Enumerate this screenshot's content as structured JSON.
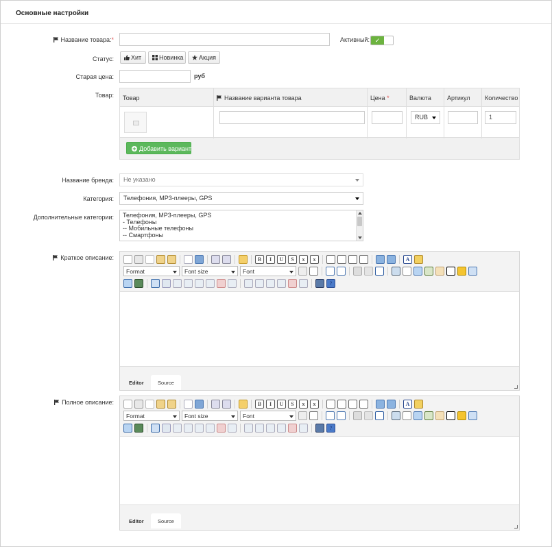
{
  "panel_title": "Основные настройки",
  "product_name": {
    "label": "Название товара:",
    "required_mark": "*",
    "value": ""
  },
  "active": {
    "label": "Активный:",
    "state": "on",
    "on_mark": "✓"
  },
  "status": {
    "label": "Статус:",
    "buttons": [
      {
        "label": "Хит",
        "icon": "thumbs-up-icon"
      },
      {
        "label": "Новинка",
        "icon": "grid-icon"
      },
      {
        "label": "Акция",
        "icon": "star-icon"
      }
    ]
  },
  "old_price": {
    "label": "Старая цена:",
    "value": "",
    "unit": "руб"
  },
  "product": {
    "label": "Товар:",
    "columns": {
      "image": "Товар",
      "variant_name": "Название варианта товара",
      "price": "Цена",
      "price_required": "*",
      "currency": "Валюта",
      "sku": "Артикул",
      "quantity": "Количество"
    },
    "row": {
      "variant_name": "",
      "price": "",
      "currency": "RUB",
      "sku": "",
      "quantity": "1"
    },
    "add_variant": "Добавить вариант"
  },
  "brand": {
    "label": "Название бренда:",
    "value": "Не указано"
  },
  "category": {
    "label": "Категория:",
    "value": "Телефония, MP3-плееры, GPS"
  },
  "extra_categories": {
    "label": "Дополнительные категории:",
    "options": [
      "Телефония, MP3-плееры, GPS",
      "- Телефоны",
      "-- Мобильные телефоны",
      "-- Смартфоны"
    ]
  },
  "short_desc": {
    "label": "Краткое описание:",
    "format": "Format",
    "font_size": "Font size",
    "font": "Font",
    "tab_editor": "Editor",
    "tab_source": "Source"
  },
  "full_desc": {
    "label": "Полное описание:",
    "format": "Format",
    "font_size": "Font size",
    "font": "Font",
    "tab_editor": "Editor",
    "tab_source": "Source"
  },
  "colors": {
    "accent_green": "#5cb85c",
    "required_red": "#e05555"
  }
}
